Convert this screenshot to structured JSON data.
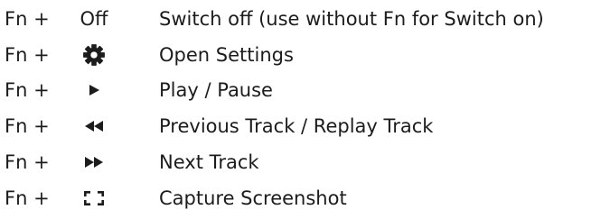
{
  "shortcuts": [
    {
      "modifier": "Fn +",
      "key_label": "Off",
      "description": "Switch off (use without Fn for Switch on)"
    },
    {
      "modifier": "Fn +",
      "key_icon": "gear-icon",
      "description": "Open Settings"
    },
    {
      "modifier": "Fn +",
      "key_icon": "play-icon",
      "description": "Play / Pause"
    },
    {
      "modifier": "Fn +",
      "key_icon": "rewind-icon",
      "description": "Previous Track / Replay Track"
    },
    {
      "modifier": "Fn +",
      "key_icon": "fast-forward-icon",
      "description": "Next Track"
    },
    {
      "modifier": "Fn +",
      "key_icon": "screenshot-icon",
      "description": "Capture Screenshot"
    }
  ],
  "colors": {
    "text": "#1c1c1c"
  }
}
